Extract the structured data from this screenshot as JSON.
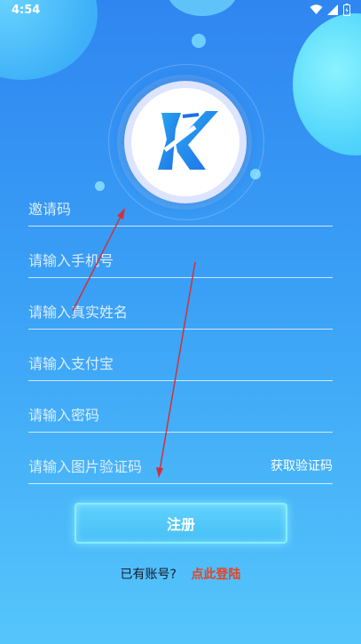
{
  "status_bar": {
    "time": "4:54",
    "icons": [
      "wifi-icon",
      "signal-icon",
      "battery-icon"
    ]
  },
  "logo": {
    "letter": "K",
    "icon": "k-logo-icon"
  },
  "form": {
    "invite_code": {
      "placeholder": "邀请码"
    },
    "phone": {
      "placeholder": "请输入手机号"
    },
    "real_name": {
      "placeholder": "请输入真实姓名"
    },
    "alipay": {
      "placeholder": "请输入支付宝"
    },
    "password": {
      "placeholder": "请输入密码"
    },
    "captcha": {
      "placeholder": "请输入图片验证码",
      "get_code_label": "获取验证码"
    }
  },
  "register_button": {
    "label": "注册"
  },
  "login_prompt": {
    "text": "已有账号?",
    "link": "点此登陆"
  },
  "colors": {
    "background_top": "#2f86f0",
    "background_bottom": "#55c6fb",
    "button_glow": "#7ff0ff",
    "login_link": "#e8421f",
    "annotation_arrow": "#d0323a"
  }
}
